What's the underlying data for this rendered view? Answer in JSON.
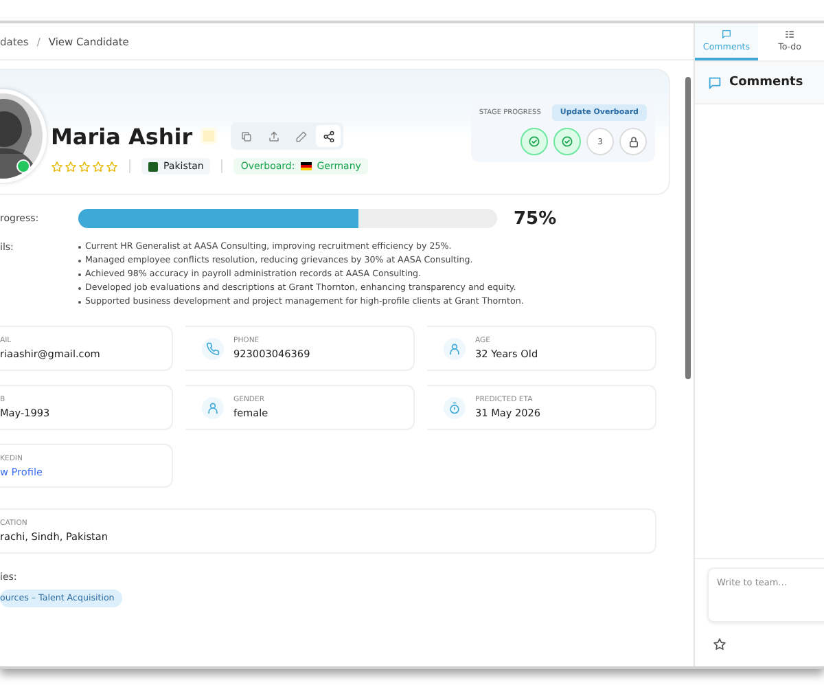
{
  "breadcrumb": {
    "items": [
      "dates",
      "View Candidate"
    ],
    "separator": "/"
  },
  "profile": {
    "name": "Maria Ashir",
    "online": true,
    "stars": 0,
    "country": "Pakistan",
    "overboard_label": "Overboard:",
    "overboard_country": "Germany"
  },
  "stage_progress": {
    "title": "STAGE PROGRESS",
    "button": "Update Overboard",
    "steps": [
      {
        "kind": "done"
      },
      {
        "kind": "done"
      },
      {
        "kind": "number",
        "label": "3"
      },
      {
        "kind": "locked"
      }
    ]
  },
  "progress": {
    "label": "rogress:",
    "level": 0.67,
    "reading": "75%"
  },
  "details": {
    "label": "ils:",
    "items": [
      "Current HR Generalist at AASA Consulting, improving recruitment efficiency by 25%.",
      "Managed employee conflicts resolution, reducing grievances by 30% at AASA Consulting.",
      "Achieved 98% accuracy in payroll administration records at AASA Consulting.",
      "Developed job evaluations and descriptions at Grant Thornton, enhancing transparency and equity.",
      "Supported business development and project management for high-profile clients at Grant Thornton."
    ]
  },
  "info_cards": [
    {
      "kind": "cut",
      "label": "AIL",
      "value": "riaashir@gmail.com"
    },
    {
      "kind": "phone",
      "label": "PHONE",
      "value": "923003046369"
    },
    {
      "kind": "person",
      "label": "AGE",
      "value": "32 Years Old"
    },
    {
      "kind": "cut",
      "label": "B",
      "value": "May-1993"
    },
    {
      "kind": "person",
      "label": "GENDER",
      "value": "female"
    },
    {
      "kind": "timer",
      "label": "PREDICTED ETA",
      "value": "31 May 2026"
    },
    {
      "kind": "link",
      "label": "KEDIN",
      "value": "w Profile"
    },
    {
      "kind": "wide",
      "label": "CATION",
      "value": "rachi, Sindh, Pakistan"
    }
  ],
  "specialties": {
    "label": "ies:",
    "tags": [
      "ources – Talent Acquisition"
    ]
  },
  "side_panel": {
    "tabs": [
      {
        "label": "Comments",
        "kind": "comment",
        "selected": true
      },
      {
        "label": "To-do",
        "kind": "todo",
        "selected": false
      }
    ],
    "heading": "Comments",
    "composer": {
      "placeholder": "Write to team..."
    }
  }
}
